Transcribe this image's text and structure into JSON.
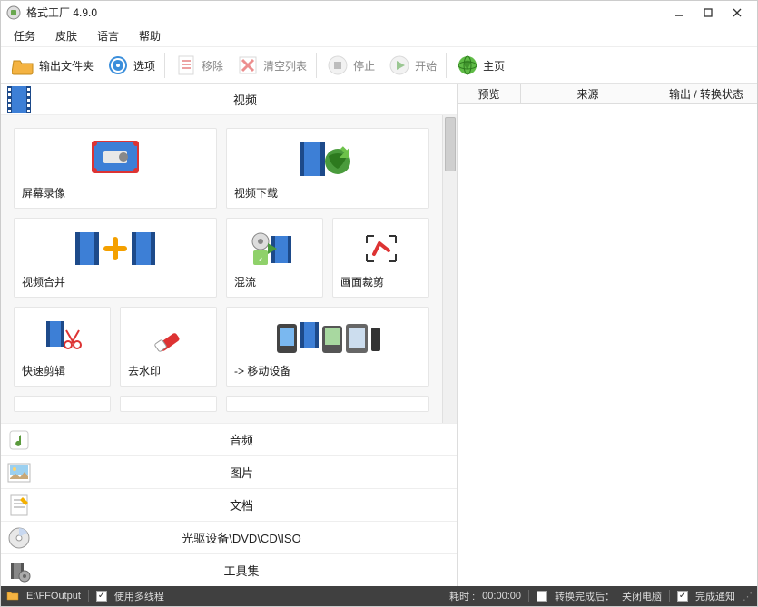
{
  "window": {
    "title": "格式工厂 4.9.0"
  },
  "menu": {
    "task": "任务",
    "skin": "皮肤",
    "lang": "语言",
    "help": "帮助"
  },
  "toolbar": {
    "output_folder": "输出文件夹",
    "options": "选项",
    "remove": "移除",
    "clear_list": "清空列表",
    "stop": "停止",
    "start": "开始",
    "homepage": "主页"
  },
  "categories": {
    "video": "视频",
    "audio": "音频",
    "image": "图片",
    "document": "文档",
    "optical": "光驱设备\\DVD\\CD\\ISO",
    "toolset": "工具集"
  },
  "video_tiles": {
    "screen_record": "屏幕录像",
    "video_download": "视频下载",
    "video_merge": "视频合并",
    "mux": "混流",
    "crop": "画面裁剪",
    "fast_clip": "快速剪辑",
    "remove_watermark": "去水印",
    "mobile": "-> 移动设备"
  },
  "right_header": {
    "preview": "预览",
    "source": "来源",
    "status": "输出 / 转换状态"
  },
  "statusbar": {
    "output_path": "E:\\FFOutput",
    "multithread": "使用多线程",
    "elapsed_label": "耗时 :",
    "elapsed_value": "00:00:00",
    "after_convert": "转换完成后：",
    "shutdown": "关闭电脑",
    "notify": "完成通知"
  }
}
